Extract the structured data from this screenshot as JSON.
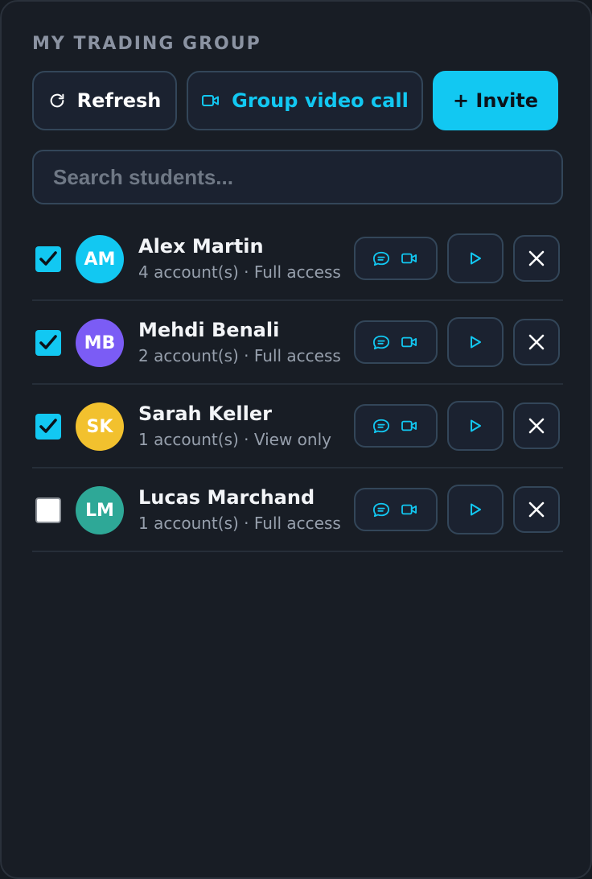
{
  "header": {
    "title": "MY TRADING GROUP"
  },
  "toolbar": {
    "refresh_label": "Refresh",
    "group_video_label": "Group video call",
    "invite_label": "+ Invite"
  },
  "search": {
    "placeholder": "Search students...",
    "value": ""
  },
  "colors": {
    "accent": "#12c8f2",
    "panel_bg": "#181d25",
    "button_bg": "#1b2230",
    "border": "#334659",
    "muted_text": "#97a0ad"
  },
  "students": [
    {
      "name": "Alex Martin",
      "initials": "AM",
      "meta": "4 account(s) · Full access",
      "selected": true,
      "avatar_color": "#12c8f2"
    },
    {
      "name": "Mehdi Benali",
      "initials": "MB",
      "meta": "2 account(s) · Full access",
      "selected": true,
      "avatar_color": "#7b5cf5"
    },
    {
      "name": "Sarah Keller",
      "initials": "SK",
      "meta": "1 account(s) · View only",
      "selected": true,
      "avatar_color": "#f2c12e"
    },
    {
      "name": "Lucas Marchand",
      "initials": "LM",
      "meta": "1 account(s) · Full access",
      "selected": false,
      "avatar_color": "#2ea897"
    }
  ],
  "icons": {
    "refresh": "refresh-icon",
    "video": "video-camera-icon",
    "chat": "chat-bubble-icon",
    "play": "play-icon",
    "remove": "close-icon",
    "check": "checkmark-icon"
  }
}
